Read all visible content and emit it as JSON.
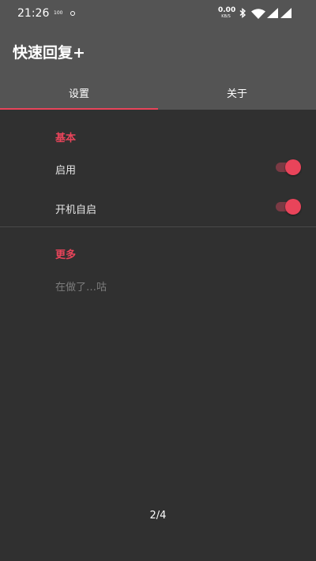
{
  "status_bar": {
    "time": "21:26",
    "small_label": "100",
    "net_speed_value": "0.00",
    "net_speed_unit": "KB/S"
  },
  "app": {
    "title": "快速回复+"
  },
  "tabs": [
    {
      "label": "设置",
      "selected": true
    },
    {
      "label": "关于",
      "selected": false
    }
  ],
  "sections": {
    "basic": {
      "title": "基本",
      "items": [
        {
          "label": "启用",
          "checked": true
        },
        {
          "label": "开机自启",
          "checked": true
        }
      ]
    },
    "more": {
      "title": "更多",
      "summary": "在做了…咕"
    }
  },
  "page_indicator": "2/4",
  "colors": {
    "accent": "#e9445a",
    "header": "#545454",
    "background": "#303030"
  }
}
